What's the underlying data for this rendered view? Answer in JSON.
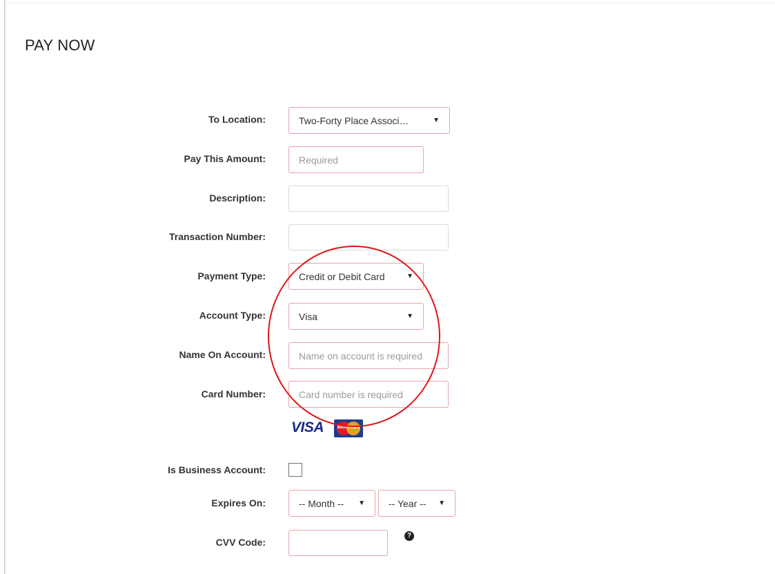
{
  "page_title": "PAY NOW",
  "form": {
    "to_location": {
      "label": "To Location:",
      "value": "Two-Forty Place Associ…"
    },
    "pay_amount": {
      "label": "Pay This Amount:",
      "placeholder": "Required"
    },
    "description": {
      "label": "Description:",
      "placeholder": ""
    },
    "transaction_number": {
      "label": "Transaction Number:",
      "placeholder": ""
    },
    "payment_type": {
      "label": "Payment Type:",
      "value": "Credit or Debit Card"
    },
    "account_type": {
      "label": "Account Type:",
      "value": "Visa"
    },
    "name_on_account": {
      "label": "Name On Account:",
      "placeholder": "Name on account is required"
    },
    "card_number": {
      "label": "Card Number:",
      "placeholder": "Card number is required"
    },
    "card_logos": {
      "visa": "VISA",
      "mastercard": "MasterCard"
    },
    "is_business_account": {
      "label": "Is Business Account:",
      "checked": false
    },
    "expires_on": {
      "label": "Expires On:",
      "month": "-- Month --",
      "year": "-- Year --"
    },
    "cvv_code": {
      "label": "CVV Code:",
      "placeholder": ""
    },
    "help_icon": "question-circle-icon"
  },
  "colors": {
    "required_border": "#e8a3a8",
    "annotation_circle": "#e01414",
    "visa_blue": "#1a2a8c"
  }
}
